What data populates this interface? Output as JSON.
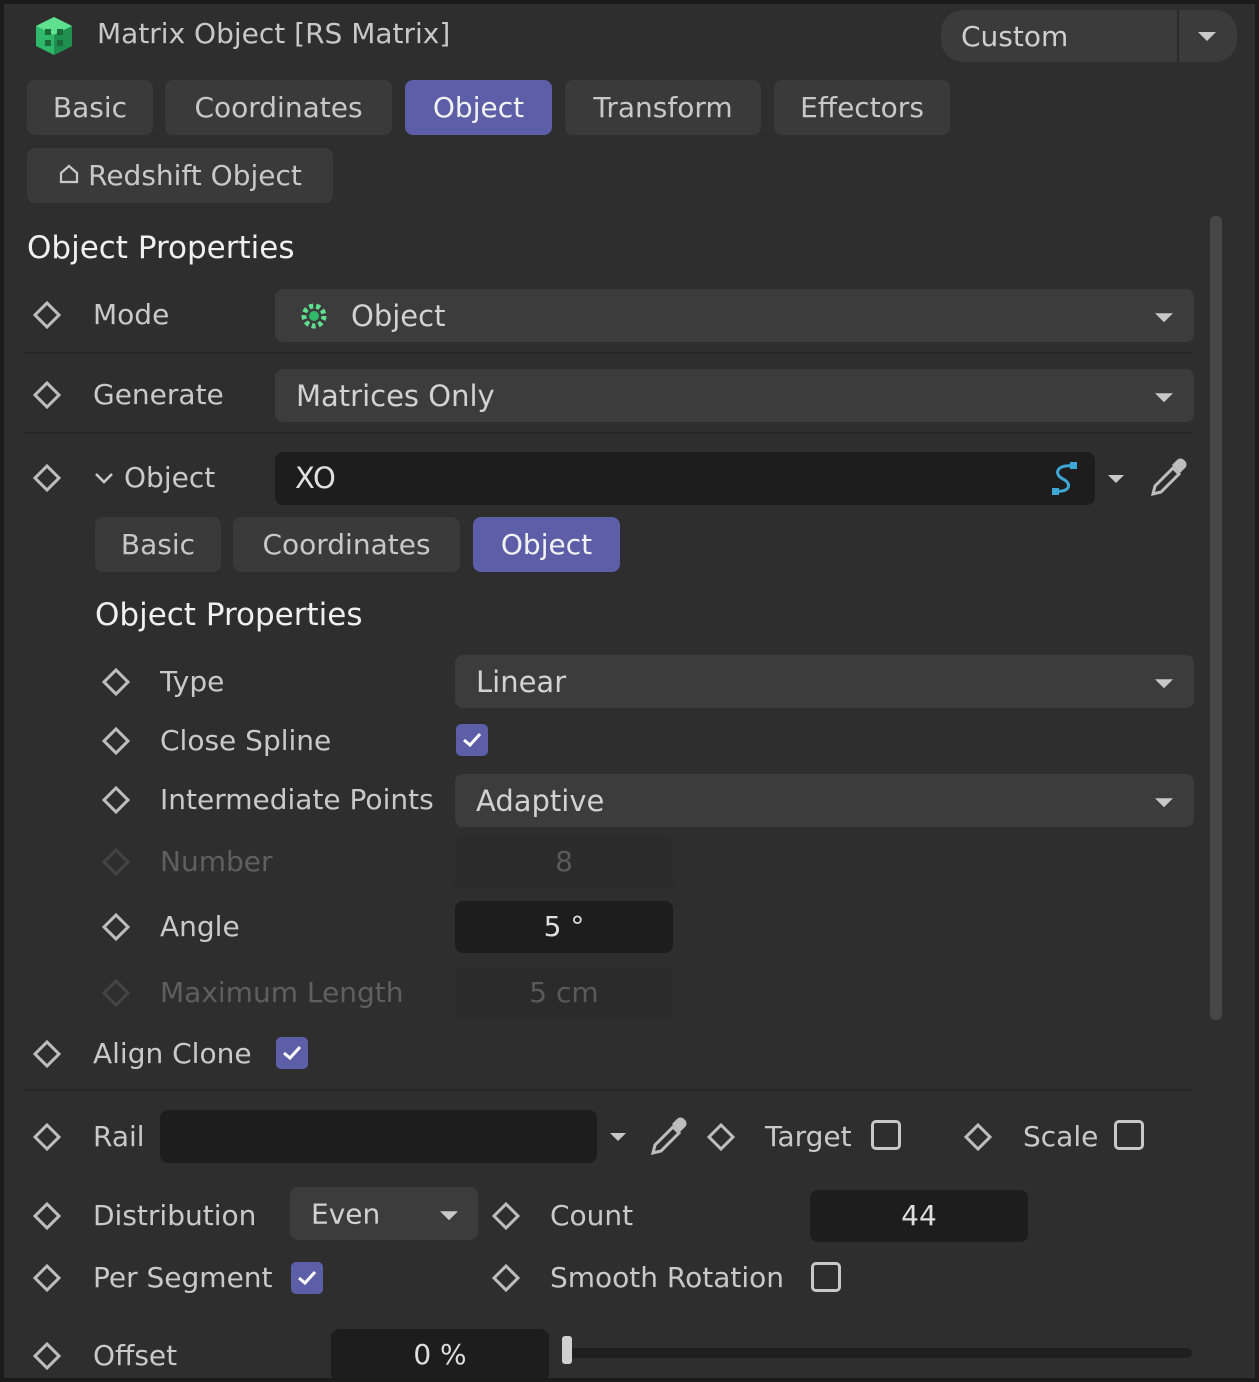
{
  "header": {
    "title": "Matrix Object [RS Matrix]",
    "layout_preset": "Custom",
    "object_icon": "matrix-cube-icon",
    "accent_color": "#5c5ea8"
  },
  "tabs": [
    {
      "label": "Basic",
      "active": false
    },
    {
      "label": "Coordinates",
      "active": false
    },
    {
      "label": "Object",
      "active": true
    },
    {
      "label": "Transform",
      "active": false
    },
    {
      "label": "Effectors",
      "active": false
    }
  ],
  "redshift_tab": {
    "label": "Redshift Object",
    "icon": "redshift-house-icon"
  },
  "section_heading": "Object Properties",
  "mode": {
    "label": "Mode",
    "value": "Object",
    "icon": "object-gear-icon"
  },
  "generate": {
    "label": "Generate",
    "value": "Matrices Only"
  },
  "object_link": {
    "label": "Object",
    "value": "XO",
    "expanded": true
  },
  "subtabs": [
    {
      "label": "Basic",
      "active": false
    },
    {
      "label": "Coordinates",
      "active": false
    },
    {
      "label": "Object",
      "active": true
    }
  ],
  "sub_section_heading": "Object Properties",
  "spline": {
    "type": {
      "label": "Type",
      "value": "Linear"
    },
    "close_spline": {
      "label": "Close Spline",
      "checked": true
    },
    "intermediate_points": {
      "label": "Intermediate Points",
      "value": "Adaptive"
    },
    "number": {
      "label": "Number",
      "value": "8",
      "enabled": false
    },
    "angle": {
      "label": "Angle",
      "value": "5 °",
      "enabled": true
    },
    "max_length": {
      "label": "Maximum Length",
      "value": "5 cm",
      "enabled": false
    }
  },
  "align_clone": {
    "label": "Align Clone",
    "checked": true
  },
  "rail": {
    "label": "Rail",
    "value": ""
  },
  "target": {
    "label": "Target",
    "checked": false
  },
  "scale": {
    "label": "Scale",
    "checked": false
  },
  "distribution": {
    "label": "Distribution",
    "value": "Even"
  },
  "count": {
    "label": "Count",
    "value": "44"
  },
  "per_segment": {
    "label": "Per Segment",
    "checked": true
  },
  "smooth_rotation": {
    "label": "Smooth Rotation",
    "checked": false
  },
  "offset": {
    "label": "Offset",
    "value": "0 %",
    "fraction": 0.0
  }
}
